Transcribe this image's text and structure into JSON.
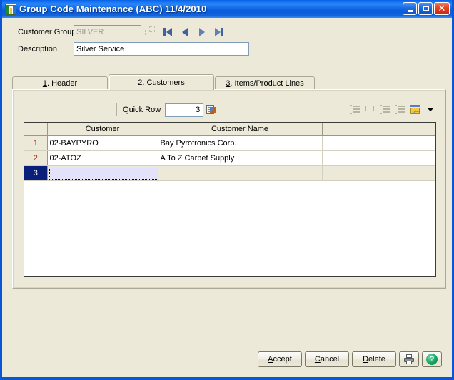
{
  "window": {
    "title": "Group Code Maintenance (ABC) 11/4/2010",
    "app_icon": "sage-grid-icon",
    "minimize_label": "",
    "maximize_label": "",
    "close_label": "✕"
  },
  "header": {
    "customer_group_label": "Customer Group",
    "customer_group_value": "SILVER",
    "customer_group_disabled": true,
    "description_label": "Description",
    "description_value": "Silver Service",
    "nav": [
      {
        "name": "first-record-button",
        "icon": "first-icon"
      },
      {
        "name": "previous-record-button",
        "icon": "previous-icon"
      },
      {
        "name": "next-record-button",
        "icon": "next-icon"
      },
      {
        "name": "last-record-button",
        "icon": "last-icon"
      }
    ]
  },
  "tabs": [
    {
      "label": "1. Header",
      "mnemonic": "1",
      "rest": ". Header",
      "active": false
    },
    {
      "label": "2. Customers",
      "mnemonic": "2",
      "rest": ". Customers",
      "active": true
    },
    {
      "label": "3. Items/Product Lines",
      "mnemonic": "3",
      "rest": ". Items/Product Lines",
      "active": false
    }
  ],
  "gridbar": {
    "quick_row_label_mnemonic": "Q",
    "quick_row_label_rest": "uick Row",
    "quick_row_value": "3",
    "quick_row_icon": "edit-page-icon",
    "tools": [
      {
        "name": "insert-row-icon",
        "enabled": false
      },
      {
        "name": "delete-row-icon",
        "enabled": false
      },
      {
        "name": "move-row-up-icon",
        "enabled": false
      },
      {
        "name": "move-row-down-icon",
        "enabled": false
      },
      {
        "name": "export-grid-icon",
        "enabled": true
      }
    ],
    "dropdown_icon": "chevron-down-icon"
  },
  "grid": {
    "columns": [
      "",
      "Customer",
      "Customer Name",
      ""
    ],
    "rows": [
      {
        "num": "1",
        "customer": "02-BAYPYRO",
        "name": "Bay Pyrotronics Corp.",
        "selected": false
      },
      {
        "num": "2",
        "customer": "02-ATOZ",
        "name": "A To Z Carpet Supply",
        "selected": false
      },
      {
        "num": "3",
        "customer": "",
        "name": "",
        "selected": true,
        "editing": true,
        "lookup_icon": "magnifier-icon"
      }
    ]
  },
  "footer": {
    "accept": {
      "mnemonic": "A",
      "rest": "ccept"
    },
    "cancel": {
      "mnemonic": "C",
      "rest": "ancel"
    },
    "delete": {
      "mnemonic": "D",
      "rest": "elete"
    },
    "print_icon": "printer-icon",
    "help_icon": "help-icon",
    "help_glyph": "?"
  }
}
